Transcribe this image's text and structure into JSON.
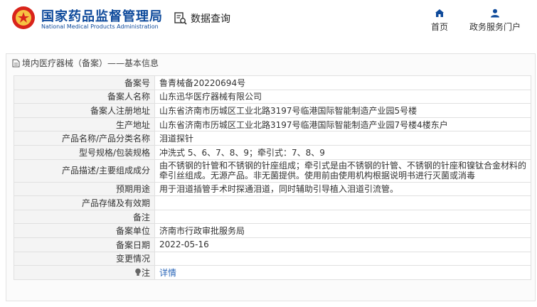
{
  "header": {
    "brand_cn": "国家药品监督管理局",
    "brand_en": "National Medical Products Administration",
    "query_label": "数据查询",
    "nav": [
      {
        "label": "首页",
        "icon": "home-icon"
      },
      {
        "label": "政务服务门户",
        "icon": "user-icon"
      }
    ]
  },
  "breadcrumb": "境内医疗器械（备案）——基本信息",
  "rows": [
    {
      "label": "备案号",
      "value": "鲁青械备20220694号"
    },
    {
      "label": "备案人名称",
      "value": "山东迅华医疗器械有限公司"
    },
    {
      "label": "备案人注册地址",
      "value": "山东省济南市历城区工业北路3197号临港国际智能制造产业园5号楼"
    },
    {
      "label": "生产地址",
      "value": "山东省济南市历城区工业北路3197号临港国际智能制造产业园7号楼4楼东户"
    },
    {
      "label": "产品名称/产品分类名称",
      "value": "泪道探针"
    },
    {
      "label": "型号规格/包装规格",
      "value": "冲洗式 5、6、7、8、9；牵引式：7、8、9"
    },
    {
      "label": "产品描述/主要组成成分",
      "value": "由不锈钢的针管和不锈钢的针座组成；牵引式是由不锈钢的针管、不锈钢的针座和镍钛合金材料的牵引丝组成。无源产品。非无菌提供。使用前由使用机构根据说明书进行灭菌或消毒"
    },
    {
      "label": "预期用途",
      "value": "用于泪道插管手术时探通泪道，同时辅助引导植入泪道引流管。"
    },
    {
      "label": "产品存储及有效期",
      "value": ""
    },
    {
      "label": "备注",
      "value": ""
    },
    {
      "label": "备案单位",
      "value": "济南市行政审批服务局"
    },
    {
      "label": "备案日期",
      "value": "2022-05-16"
    },
    {
      "label": "变更情况",
      "value": ""
    },
    {
      "label": "注",
      "value": "详情"
    }
  ]
}
